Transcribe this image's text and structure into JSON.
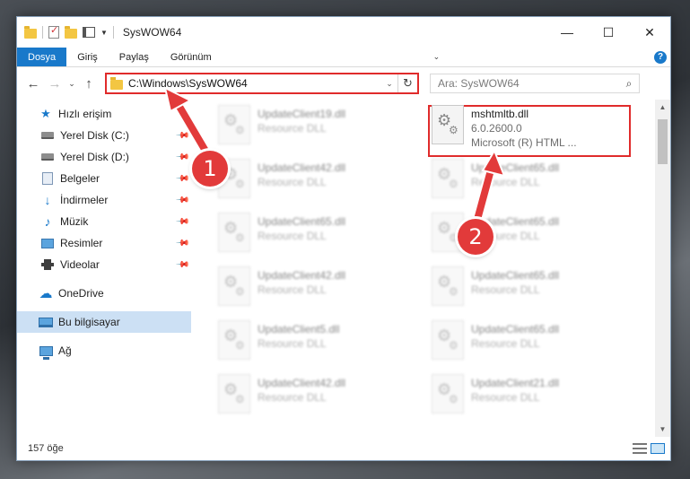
{
  "window": {
    "title": "SysWOW64",
    "controls": {
      "minimize": "—",
      "maximize": "☐",
      "close": "✕"
    }
  },
  "ribbon": {
    "tabs": [
      {
        "label": "Dosya",
        "active": true
      },
      {
        "label": "Giriş"
      },
      {
        "label": "Paylaş"
      },
      {
        "label": "Görünüm"
      }
    ],
    "help": "?"
  },
  "address": {
    "path": "C:\\Windows\\SysWOW64",
    "search_placeholder": "Ara: SysWOW64"
  },
  "nav": {
    "quick_access": "Hızlı erişim",
    "items": [
      {
        "label": "Yerel Disk (C:)",
        "icon": "drive-icon",
        "pinned": true
      },
      {
        "label": "Yerel Disk (D:)",
        "icon": "drive-icon",
        "pinned": true
      },
      {
        "label": "Belgeler",
        "icon": "documents-icon",
        "pinned": true
      },
      {
        "label": "İndirmeler",
        "icon": "downloads-icon",
        "pinned": true
      },
      {
        "label": "Müzik",
        "icon": "music-icon",
        "pinned": true
      },
      {
        "label": "Resimler",
        "icon": "pictures-icon",
        "pinned": true
      },
      {
        "label": "Videolar",
        "icon": "videos-icon",
        "pinned": true
      }
    ],
    "onedrive": "OneDrive",
    "this_pc": "Bu bilgisayar",
    "network": "Ağ"
  },
  "files": {
    "left_column": [
      {
        "name": "UpdateClient19.dll",
        "type": "Resource DLL"
      },
      {
        "name": "UpdateClient42.dll",
        "type": "Resource DLL"
      },
      {
        "name": "UpdateClient65.dll",
        "type": "Resource DLL"
      },
      {
        "name": "UpdateClient42.dll",
        "type": "Resource DLL"
      },
      {
        "name": "UpdateClient5.dll",
        "type": "Resource DLL"
      },
      {
        "name": "UpdateClient42.dll",
        "type": "Resource DLL"
      }
    ],
    "right_column": [
      {
        "name": "mshtmltb.dll",
        "version": "6.0.2600.0",
        "description": "Microsoft (R) HTML ...",
        "highlighted": true
      },
      {
        "name": "UpdateClient65.dll",
        "type": "Resource DLL"
      },
      {
        "name": "UpdateClient65.dll",
        "type": "Resource DLL"
      },
      {
        "name": "UpdateClient65.dll",
        "type": "Resource DLL"
      },
      {
        "name": "UpdateClient65.dll",
        "type": "Resource DLL"
      },
      {
        "name": "UpdateClient21.dll",
        "type": "Resource DLL"
      }
    ]
  },
  "status": {
    "count": "157 öğe"
  },
  "annotations": {
    "badge1": "1",
    "badge2": "2",
    "color": "#e23a3a"
  }
}
